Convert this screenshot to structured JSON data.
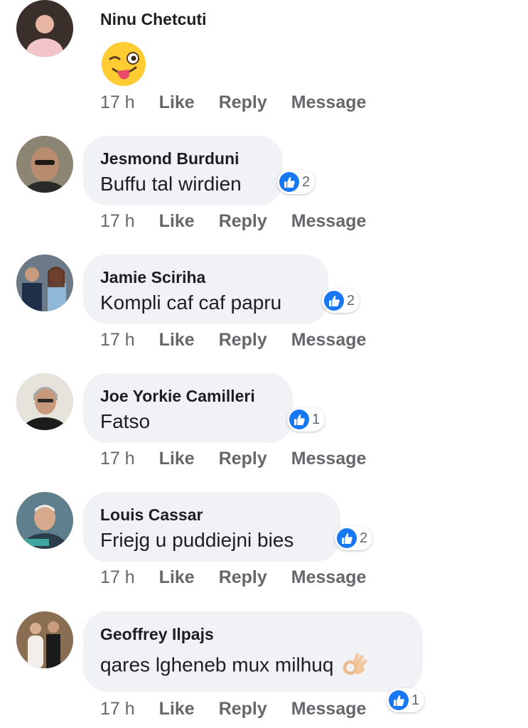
{
  "actions": {
    "time": "17 h",
    "like": "Like",
    "reply": "Reply",
    "message": "Message"
  },
  "comments": [
    {
      "author": "Ninu Chetcuti",
      "emoji": "winking-face-with-tongue"
    },
    {
      "author": "Jesmond Burduni",
      "text": "Buffu tal wirdien",
      "reaction_count": "2"
    },
    {
      "author": "Jamie Sciriha",
      "text": "Kompli caf caf papru",
      "reaction_count": "2"
    },
    {
      "author": "Joe Yorkie Camilleri",
      "text": "Fatso",
      "reaction_count": "1"
    },
    {
      "author": "Louis Cassar",
      "text": "Friejg u puddiejni bies",
      "reaction_count": "2"
    },
    {
      "author": "Geoffrey Ilpajs",
      "text": "qares lgheneb mux milhuq",
      "emoji": "ok-hand",
      "reaction_count": "1"
    }
  ],
  "colors": {
    "bubble": "#f0f2f5",
    "like_badge": "#1877f2",
    "action_text": "#65676b"
  }
}
